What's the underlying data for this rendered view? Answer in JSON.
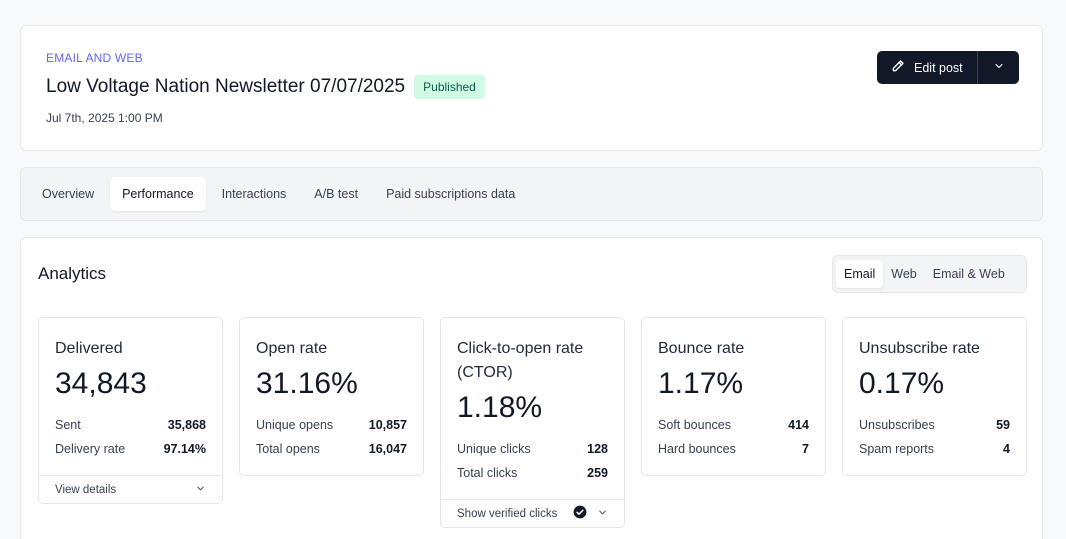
{
  "header": {
    "eyebrow": "EMAIL AND WEB",
    "title": "Low Voltage Nation Newsletter 07/07/2025",
    "status": "Published",
    "date": "Jul 7th, 2025 1:00 PM",
    "edit_label": "Edit post"
  },
  "tabs": [
    "Overview",
    "Performance",
    "Interactions",
    "A/B test",
    "Paid subscriptions data"
  ],
  "analytics": {
    "title": "Analytics",
    "segments": [
      "Email",
      "Web",
      "Email & Web"
    ],
    "metrics": [
      {
        "label": "Delivered",
        "value": "34,843",
        "stats": [
          {
            "label": "Sent",
            "value": "35,868"
          },
          {
            "label": "Delivery rate",
            "value": "97.14%"
          }
        ],
        "footer": "View details"
      },
      {
        "label": "Open rate",
        "value": "31.16%",
        "stats": [
          {
            "label": "Unique opens",
            "value": "10,857"
          },
          {
            "label": "Total opens",
            "value": "16,047"
          }
        ]
      },
      {
        "label": "Click-to-open rate (CTOR)",
        "value": "1.18%",
        "stats": [
          {
            "label": "Unique clicks",
            "value": "128"
          },
          {
            "label": "Total clicks",
            "value": "259"
          }
        ],
        "footer": "Show verified clicks"
      },
      {
        "label": "Bounce rate",
        "value": "1.17%",
        "stats": [
          {
            "label": "Soft bounces",
            "value": "414"
          },
          {
            "label": "Hard bounces",
            "value": "7"
          }
        ]
      },
      {
        "label": "Unsubscribe rate",
        "value": "0.17%",
        "stats": [
          {
            "label": "Unsubscribes",
            "value": "59"
          },
          {
            "label": "Spam reports",
            "value": "4"
          }
        ]
      }
    ]
  },
  "colors": {
    "accent": "#6366f1",
    "badge_bg": "#d1fae5",
    "badge_text": "#065f46",
    "primary_button": "#111827"
  },
  "icons": {
    "edit": "pencil-icon",
    "caret": "chevron-down-icon",
    "verified": "check-circle-icon"
  }
}
